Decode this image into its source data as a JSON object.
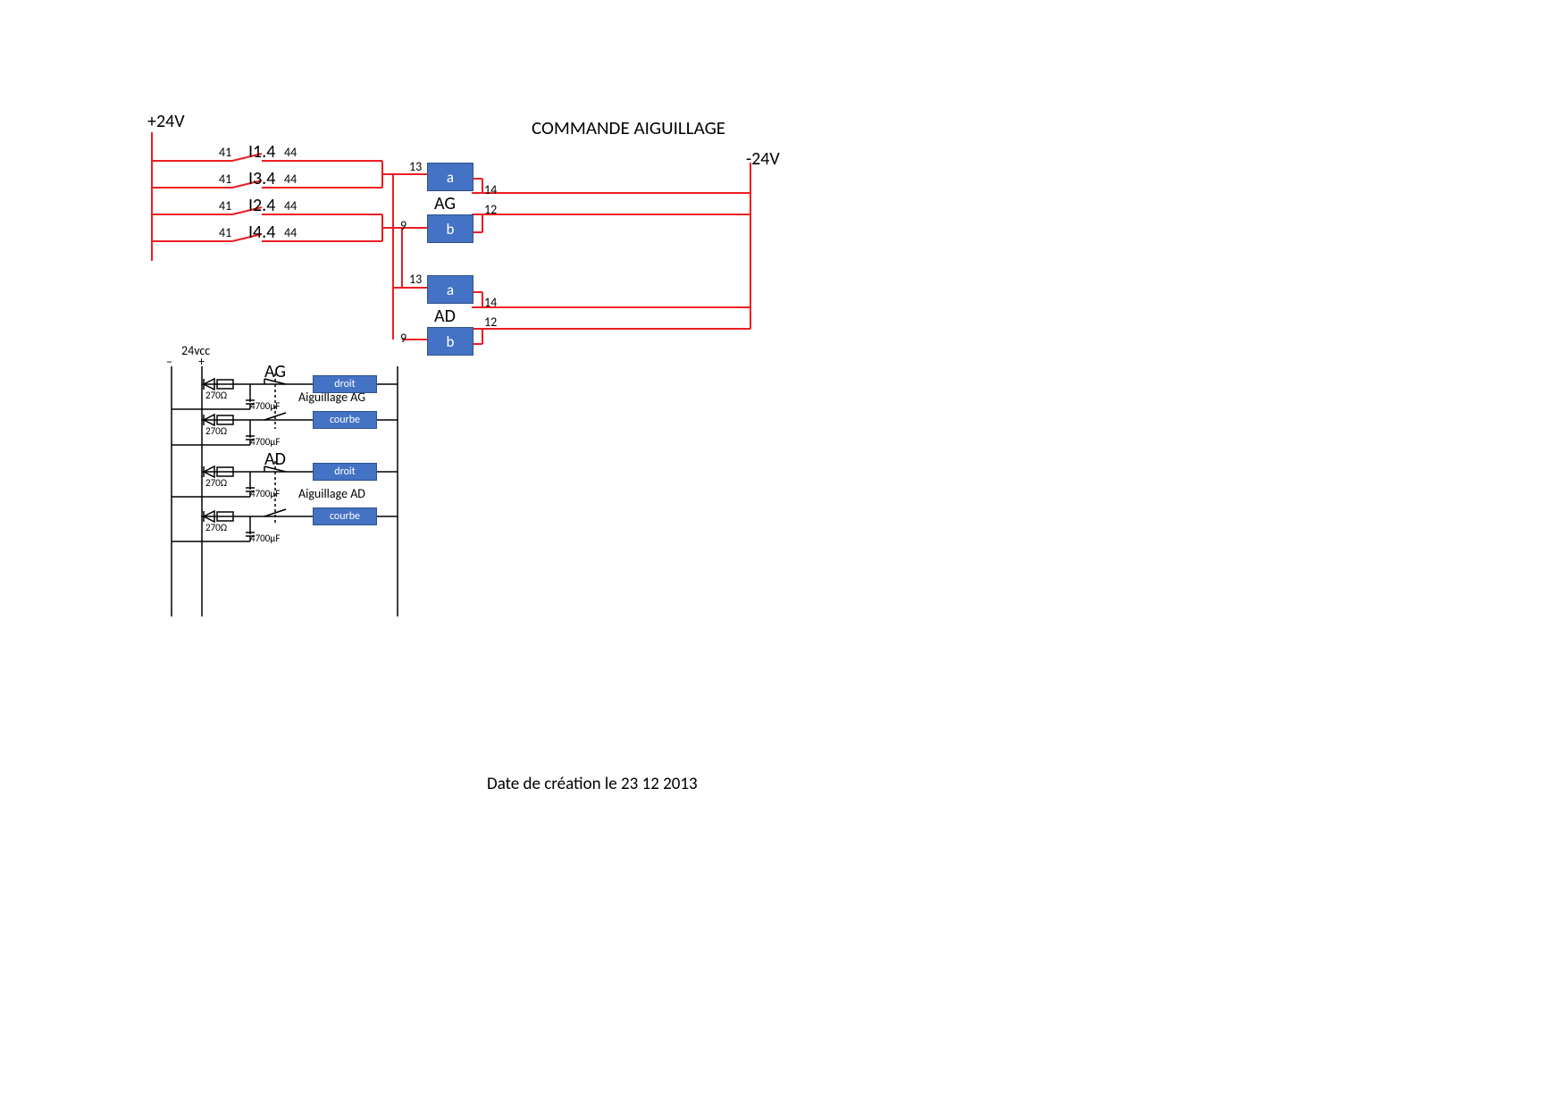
{
  "title": "COMMANDE AIGUILLAGE",
  "footer": "Date de création le 23 12 2013",
  "rails": {
    "pos": "+24V",
    "neg": "-24V",
    "dc": "24vcc",
    "dc_plus": "+",
    "dc_minus": "–"
  },
  "contacts": [
    {
      "left": "41",
      "ref": "I1.4",
      "right": "44"
    },
    {
      "left": "41",
      "ref": "I3.4",
      "right": "44"
    },
    {
      "left": "41",
      "ref": "I2.4",
      "right": "44"
    },
    {
      "left": "41",
      "ref": "I4.4",
      "right": "44"
    }
  ],
  "relays": {
    "ag": {
      "name": "AG",
      "a": "a",
      "b": "b",
      "pins": {
        "p13": "13",
        "p14": "14",
        "p9": "9",
        "p12": "12"
      }
    },
    "ad": {
      "name": "AD",
      "a": "a",
      "b": "b",
      "pins": {
        "p13": "13",
        "p14": "14",
        "p9": "9",
        "p12": "12"
      }
    }
  },
  "lower": {
    "sections": [
      {
        "name": "AG",
        "desc": "Aiguillage AG",
        "rows": [
          {
            "r": "270Ω",
            "c": "4700µF",
            "btn": "droit"
          },
          {
            "r": "270Ω",
            "c": "4700µF",
            "btn": "courbe"
          }
        ]
      },
      {
        "name": "AD",
        "desc": "Aiguillage AD",
        "rows": [
          {
            "r": "270Ω",
            "c": "4700µF",
            "btn": "droit"
          },
          {
            "r": "270Ω",
            "c": "4700µF",
            "btn": "courbe"
          }
        ]
      }
    ]
  }
}
